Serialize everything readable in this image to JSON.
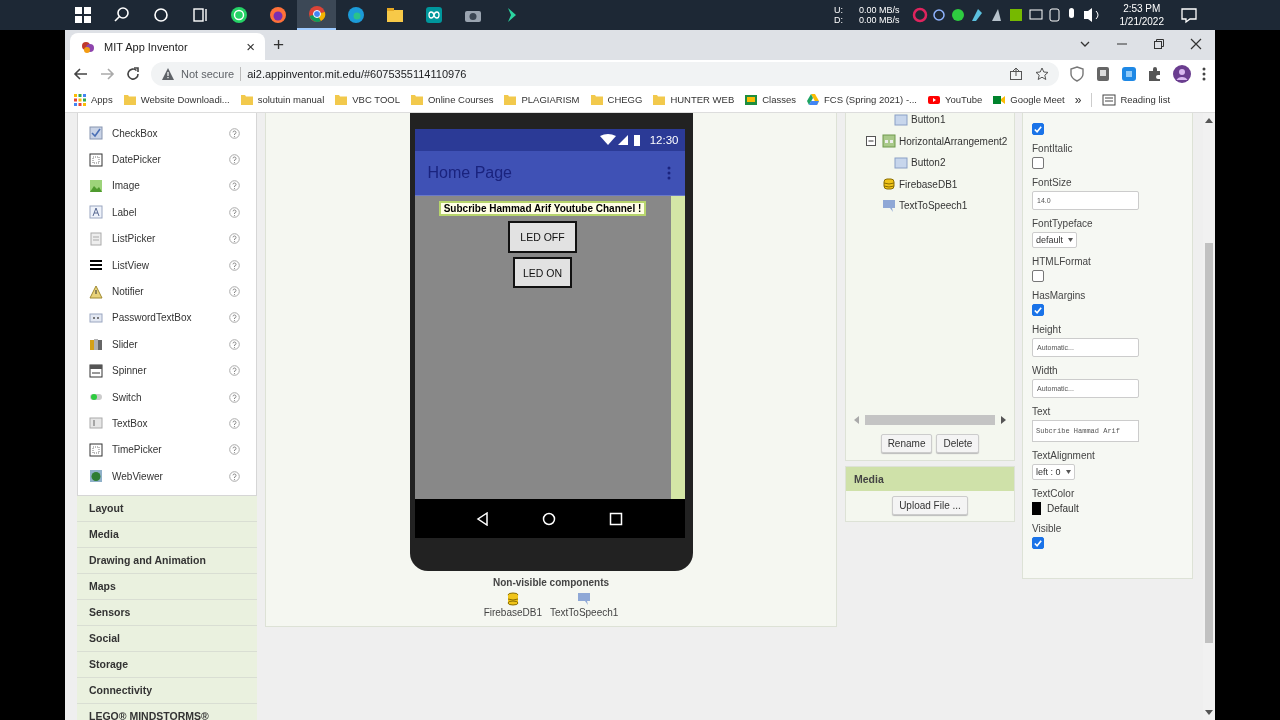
{
  "taskbar": {
    "apps": [
      {
        "kind": "start",
        "selected": false
      },
      {
        "kind": "search",
        "selected": false
      },
      {
        "kind": "cortana",
        "selected": false
      },
      {
        "kind": "taskview",
        "selected": false
      },
      {
        "kind": "chat",
        "selected": false
      },
      {
        "kind": "fox",
        "selected": false
      },
      {
        "kind": "chrome",
        "selected": true
      },
      {
        "kind": "edge",
        "selected": false
      },
      {
        "kind": "folder",
        "selected": false
      },
      {
        "kind": "infinity",
        "selected": false
      },
      {
        "kind": "camera",
        "selected": false
      },
      {
        "kind": "diamond",
        "selected": false
      }
    ],
    "net_labels": [
      "U:",
      "D:"
    ],
    "net_rates": [
      "0.00 MB/s",
      "0.00 MB/s"
    ],
    "time": "2:53 PM",
    "date": "1/21/2022"
  },
  "browser": {
    "tab": {
      "title": "MIT App Inventor",
      "close": "×"
    },
    "new_tab": "+",
    "security": "Not secure",
    "url": "ai2.appinventor.mit.edu/#6075355114110976",
    "bookmarks": [
      {
        "kind": "apps",
        "label": "Apps"
      },
      {
        "kind": "folder",
        "label": "Website Downloadi..."
      },
      {
        "kind": "folder",
        "label": "solutuin manual"
      },
      {
        "kind": "folder",
        "label": "VBC TOOL"
      },
      {
        "kind": "folder",
        "label": "Online Courses"
      },
      {
        "kind": "folder",
        "label": "PLAGIARISM"
      },
      {
        "kind": "folder",
        "label": "CHEGG"
      },
      {
        "kind": "folder",
        "label": "HUNTER WEB"
      },
      {
        "kind": "classroom",
        "label": "Classes"
      },
      {
        "kind": "drive",
        "label": "FCS (Spring 2021) -..."
      },
      {
        "kind": "youtube",
        "label": "YouTube"
      },
      {
        "kind": "meet",
        "label": "Google Meet"
      }
    ],
    "more": "»",
    "reading_list": "Reading list"
  },
  "palette": {
    "items": [
      {
        "kind": "checkbox",
        "label": "CheckBox"
      },
      {
        "kind": "datepicker",
        "label": "DatePicker"
      },
      {
        "kind": "image",
        "label": "Image"
      },
      {
        "kind": "label",
        "label": "Label"
      },
      {
        "kind": "listpicker",
        "label": "ListPicker"
      },
      {
        "kind": "listview",
        "label": "ListView"
      },
      {
        "kind": "notifier",
        "label": "Notifier"
      },
      {
        "kind": "password",
        "label": "PasswordTextBox"
      },
      {
        "kind": "slider",
        "label": "Slider"
      },
      {
        "kind": "spinner",
        "label": "Spinner"
      },
      {
        "kind": "switch",
        "label": "Switch"
      },
      {
        "kind": "textbox",
        "label": "TextBox"
      },
      {
        "kind": "timepicker",
        "label": "TimePicker"
      },
      {
        "kind": "webviewer",
        "label": "WebViewer"
      }
    ],
    "categories": [
      "Layout",
      "Media",
      "Drawing and Animation",
      "Maps",
      "Sensors",
      "Social",
      "Storage",
      "Connectivity",
      "LEGO® MINDSTORMS®"
    ]
  },
  "viewer": {
    "phone": {
      "time": "12:30",
      "title": "Home Page",
      "label": "Subcribe Hammad Arif Youtube Channel !",
      "buttons": [
        "LED OFF",
        "LED ON"
      ]
    },
    "nonvisible_title": "Non-visible components",
    "nonvisible": [
      {
        "kind": "database",
        "label": "FirebaseDB1"
      },
      {
        "kind": "speech",
        "label": "TextToSpeech1"
      }
    ]
  },
  "components": {
    "tree": [
      {
        "children": [
          {
            "kind": "button",
            "label": "Button1"
          }
        ]
      },
      {
        "kind": "arrangement",
        "label": "HorizontalArrangement2",
        "expanded": true,
        "children": [
          {
            "kind": "button",
            "label": "Button2"
          }
        ]
      },
      {
        "kind": "database",
        "label": "FirebaseDB1"
      },
      {
        "kind": "speech",
        "label": "TextToSpeech1"
      }
    ],
    "buttons": [
      "Rename",
      "Delete"
    ]
  },
  "media": {
    "title": "Media",
    "button": "Upload File ..."
  },
  "properties": [
    {
      "kind": "checkbox",
      "checked": true
    },
    {
      "kind": "checkbox",
      "label": "FontItalic",
      "checked": false
    },
    {
      "kind": "text",
      "label": "FontSize",
      "value": "14.0"
    },
    {
      "kind": "dropdown",
      "label": "FontTypeface",
      "value": "default"
    },
    {
      "kind": "checkbox",
      "label": "HTMLFormat",
      "checked": false
    },
    {
      "kind": "checkbox",
      "label": "HasMargins",
      "checked": true
    },
    {
      "kind": "text",
      "label": "Height",
      "value": "Automatic..."
    },
    {
      "kind": "text",
      "label": "Width",
      "value": "Automatic..."
    },
    {
      "kind": "textarea",
      "label": "Text",
      "value": "Subcribe Hammad Arif"
    },
    {
      "kind": "dropdown",
      "label": "TextAlignment",
      "value": "left : 0"
    },
    {
      "kind": "color",
      "label": "TextColor",
      "value": "Default",
      "color": "#000000"
    },
    {
      "kind": "checkbox",
      "label": "Visible",
      "checked": true
    }
  ]
}
